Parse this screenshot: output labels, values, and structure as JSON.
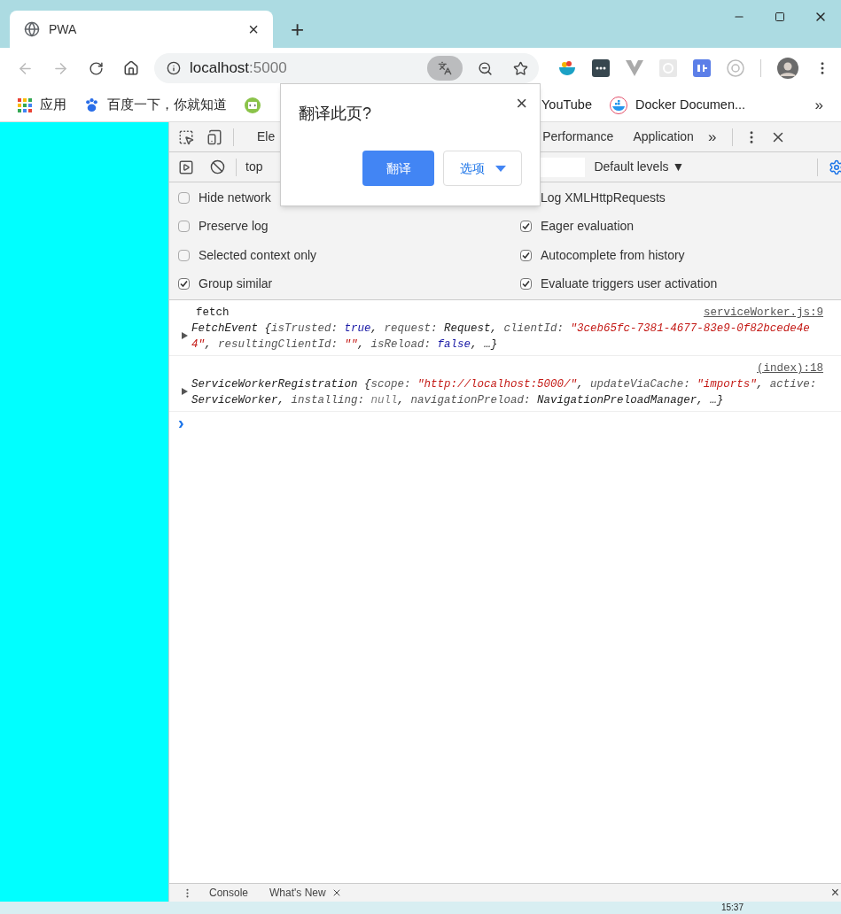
{
  "browser_tab": {
    "title": "PWA",
    "close": "×",
    "new_tab": "+"
  },
  "address_bar": {
    "host": "localhost",
    "port": ":5000"
  },
  "bookmarks": [
    {
      "kind": "apps",
      "label": "应用"
    },
    {
      "kind": "paw",
      "label": "百度一下，你就知道"
    },
    {
      "kind": "code"
    },
    {
      "kind": "plain",
      "label": "YouTube"
    },
    {
      "kind": "whale",
      "label": "Docker Documen..."
    }
  ],
  "bookmarks_more": "»",
  "translate_popup": {
    "title": "翻译此页?",
    "close": "×",
    "translate_button": "翻译",
    "options_button": "选项"
  },
  "devtools": {
    "tabs": [
      {
        "label": "Ele",
        "selected": false
      },
      {
        "label": "Performance",
        "selected": false
      },
      {
        "label": "Application",
        "selected": false
      }
    ],
    "more_tabs": "»",
    "context": "top",
    "levels": "Default levels ▼",
    "settings_left": [
      {
        "label": "Hide network",
        "checked": false
      },
      {
        "label": "Preserve log",
        "checked": false
      },
      {
        "label": "Selected context only",
        "checked": false
      },
      {
        "label": "Group similar",
        "checked": true
      }
    ],
    "settings_right": [
      {
        "label": "Log XMLHttpRequests",
        "kind": "covered"
      },
      {
        "label": "Eager evaluation",
        "kind": "checkbox",
        "checked": true
      },
      {
        "label": "Autocomplete from history",
        "kind": "checkbox",
        "checked": true
      },
      {
        "label": "Evaluate triggers user activation",
        "kind": "checkbox",
        "checked": true
      }
    ],
    "messages": [
      {
        "heading": "fetch",
        "source": "serviceWorker.js:9",
        "segments": [
          {
            "kind": "plain",
            "text": "FetchEvent {"
          },
          {
            "kind": "key",
            "text": "isTrusted: "
          },
          {
            "kind": "keyword",
            "text": "true"
          },
          {
            "kind": "plain",
            "text": ", "
          },
          {
            "kind": "key",
            "text": "request: "
          },
          {
            "kind": "plain",
            "text": "Request, "
          },
          {
            "kind": "key",
            "text": "clientId: "
          },
          {
            "kind": "string",
            "text": "\"3ceb65fc-7381-4677-83e9-0f82bcede4e4\""
          },
          {
            "kind": "plain",
            "text": ", "
          },
          {
            "kind": "key",
            "text": "resultingClientId: "
          },
          {
            "kind": "string",
            "text": "\"\""
          },
          {
            "kind": "plain",
            "text": ", "
          },
          {
            "kind": "key",
            "text": "isReload: "
          },
          {
            "kind": "keyword",
            "text": "false"
          },
          {
            "kind": "plain",
            "text": ", …}"
          }
        ]
      },
      {
        "source": "(index):18",
        "segments": [
          {
            "kind": "plain",
            "text": "ServiceWorkerRegistration {"
          },
          {
            "kind": "key",
            "text": "scope: "
          },
          {
            "kind": "string",
            "text": "\"http://localhost:5000/\""
          },
          {
            "kind": "plain",
            "text": ", "
          },
          {
            "kind": "key",
            "text": "updateViaCache: "
          },
          {
            "kind": "string",
            "text": "\"imports\""
          },
          {
            "kind": "plain",
            "text": ", "
          },
          {
            "kind": "key",
            "text": "active: "
          },
          {
            "kind": "plain",
            "text": "ServiceWorker, "
          },
          {
            "kind": "key",
            "text": "installing: "
          },
          {
            "kind": "null",
            "text": "null"
          },
          {
            "kind": "plain",
            "text": ", "
          },
          {
            "kind": "key",
            "text": "navigationPreload: "
          },
          {
            "kind": "plain",
            "text": "NavigationPreloadManager, …}"
          }
        ]
      }
    ],
    "prompt": "›",
    "drawer_tabs": [
      {
        "label": "Console",
        "closable": false
      },
      {
        "label": "What's New",
        "closable": true
      }
    ],
    "drawer_close": "×"
  },
  "taskbar": {
    "clock": "15:37"
  }
}
